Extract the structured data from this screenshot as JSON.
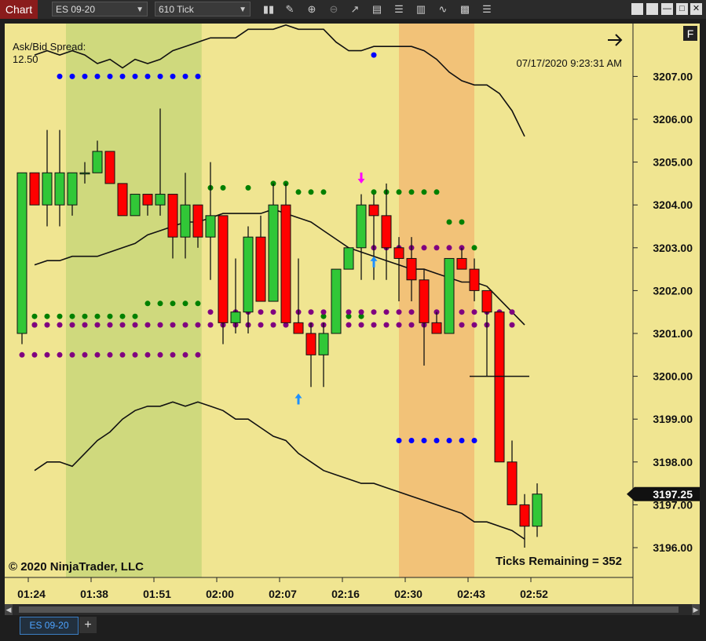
{
  "toolbar": {
    "chart_label": "Chart",
    "instrument": "ES 09-20",
    "interval": "610 Tick"
  },
  "panel": {
    "spread_label": "Ask/Bid Spread:",
    "spread_value": "12.50",
    "datetime": "07/17/2020 9:23:31 AM",
    "copyright": "© 2020 NinjaTrader, LLC",
    "ticks_remaining": "Ticks Remaining = 352",
    "f_badge": "F"
  },
  "bottom": {
    "instrument_tab": "ES 09-20",
    "add_tab": "+"
  },
  "colors": {
    "background": "#f0e591",
    "green_zone": "#cfd97d",
    "orange_zone": "#f2c278",
    "bull": "#31c737",
    "bear": "#ff0000",
    "frame": "#1e1e1e"
  },
  "chart_data": {
    "type": "candlestick",
    "instrument": "ES 09-20",
    "bar_type": "610 Tick",
    "y_axis": {
      "ticks": [
        "3196.00",
        "3197.00",
        "3198.00",
        "3199.00",
        "3200.00",
        "3201.00",
        "3202.00",
        "3203.00",
        "3204.00",
        "3205.00",
        "3206.00",
        "3207.00"
      ],
      "range": [
        3195.5,
        3208.1
      ],
      "last_price": "3197.25"
    },
    "x_axis": {
      "ticks": [
        {
          "label": "01:24",
          "bar": 1
        },
        {
          "label": "01:38",
          "bar": 6
        },
        {
          "label": "01:51",
          "bar": 11
        },
        {
          "label": "02:00",
          "bar": 16
        },
        {
          "label": "02:07",
          "bar": 21
        },
        {
          "label": "02:16",
          "bar": 26
        },
        {
          "label": "02:30",
          "bar": 31
        },
        {
          "label": "02:43",
          "bar": 36
        },
        {
          "label": "02:52",
          "bar": 41
        }
      ]
    },
    "candles": [
      {
        "o": 3201.0,
        "h": 3204.0,
        "l": 3200.75,
        "c": 3204.75
      },
      {
        "o": 3204.75,
        "h": 3204.75,
        "l": 3204.0,
        "c": 3204.0
      },
      {
        "o": 3204.0,
        "h": 3205.75,
        "l": 3203.5,
        "c": 3204.75
      },
      {
        "o": 3204.0,
        "h": 3205.75,
        "l": 3203.5,
        "c": 3204.75
      },
      {
        "o": 3204.0,
        "h": 3204.75,
        "l": 3203.75,
        "c": 3204.75
      },
      {
        "o": 3204.75,
        "h": 3205.0,
        "l": 3204.5,
        "c": 3204.75
      },
      {
        "o": 3204.75,
        "h": 3205.5,
        "l": 3204.75,
        "c": 3205.25
      },
      {
        "o": 3205.25,
        "h": 3205.25,
        "l": 3204.5,
        "c": 3204.5
      },
      {
        "o": 3204.5,
        "h": 3204.5,
        "l": 3203.75,
        "c": 3203.75
      },
      {
        "o": 3203.75,
        "h": 3204.25,
        "l": 3203.75,
        "c": 3204.25
      },
      {
        "o": 3204.25,
        "h": 3204.25,
        "l": 3203.75,
        "c": 3204.0
      },
      {
        "o": 3204.0,
        "h": 3206.25,
        "l": 3203.75,
        "c": 3204.25
      },
      {
        "o": 3204.25,
        "h": 3204.25,
        "l": 3202.75,
        "c": 3203.25
      },
      {
        "o": 3203.25,
        "h": 3204.75,
        "l": 3202.75,
        "c": 3204.0
      },
      {
        "o": 3204.0,
        "h": 3204.0,
        "l": 3203.0,
        "c": 3203.25
      },
      {
        "o": 3203.25,
        "h": 3205.0,
        "l": 3202.25,
        "c": 3203.75
      },
      {
        "o": 3203.75,
        "h": 3203.75,
        "l": 3200.75,
        "c": 3201.25
      },
      {
        "o": 3201.25,
        "h": 3202.75,
        "l": 3201.0,
        "c": 3201.5
      },
      {
        "o": 3201.5,
        "h": 3203.5,
        "l": 3201.0,
        "c": 3203.25
      },
      {
        "o": 3203.25,
        "h": 3203.75,
        "l": 3201.75,
        "c": 3201.75
      },
      {
        "o": 3201.75,
        "h": 3204.5,
        "l": 3201.75,
        "c": 3204.0
      },
      {
        "o": 3204.0,
        "h": 3204.5,
        "l": 3201.25,
        "c": 3201.25
      },
      {
        "o": 3201.25,
        "h": 3202.75,
        "l": 3201.0,
        "c": 3201.0
      },
      {
        "o": 3201.0,
        "h": 3201.25,
        "l": 3199.75,
        "c": 3200.5
      },
      {
        "o": 3200.5,
        "h": 3201.25,
        "l": 3199.75,
        "c": 3201.0
      },
      {
        "o": 3201.0,
        "h": 3202.5,
        "l": 3201.0,
        "c": 3202.5
      },
      {
        "o": 3202.5,
        "h": 3203.0,
        "l": 3202.5,
        "c": 3203.0
      },
      {
        "o": 3203.0,
        "h": 3204.25,
        "l": 3202.25,
        "c": 3204.0
      },
      {
        "o": 3204.0,
        "h": 3204.25,
        "l": 3202.25,
        "c": 3203.75
      },
      {
        "o": 3203.75,
        "h": 3204.5,
        "l": 3202.25,
        "c": 3203.0
      },
      {
        "o": 3203.0,
        "h": 3203.25,
        "l": 3201.75,
        "c": 3202.75
      },
      {
        "o": 3202.75,
        "h": 3203.25,
        "l": 3201.75,
        "c": 3202.25
      },
      {
        "o": 3202.25,
        "h": 3202.5,
        "l": 3200.25,
        "c": 3201.25
      },
      {
        "o": 3201.25,
        "h": 3201.5,
        "l": 3201.0,
        "c": 3201.0
      },
      {
        "o": 3201.0,
        "h": 3202.75,
        "l": 3201.0,
        "c": 3202.75
      },
      {
        "o": 3202.75,
        "h": 3203.0,
        "l": 3202.5,
        "c": 3202.5
      },
      {
        "o": 3202.5,
        "h": 3202.75,
        "l": 3201.75,
        "c": 3202.0
      },
      {
        "o": 3202.0,
        "h": 3202.0,
        "l": 3200.0,
        "c": 3201.5
      },
      {
        "o": 3201.5,
        "h": 3201.5,
        "l": 3198.0,
        "c": 3198.0
      },
      {
        "o": 3198.0,
        "h": 3198.5,
        "l": 3197.0,
        "c": 3197.0
      },
      {
        "o": 3197.0,
        "h": 3197.25,
        "l": 3196.0,
        "c": 3196.5
      },
      {
        "o": 3196.5,
        "h": 3197.5,
        "l": 3196.25,
        "c": 3197.25
      }
    ],
    "upper_band": [
      3207.5,
      3207.6,
      3207.5,
      3207.6,
      3207.5,
      3207.3,
      3207.4,
      3207.2,
      3207.4,
      3207.3,
      3207.4,
      3207.6,
      3207.7,
      3207.8,
      3207.9,
      3207.9,
      3207.9,
      3208.1,
      3208.1,
      3208.1,
      3208.2,
      3208.1,
      3208.1,
      3208.1,
      3207.8,
      3207.6,
      3207.6,
      3207.7,
      3207.7,
      3207.7,
      3207.7,
      3207.6,
      3207.4,
      3207.1,
      3206.9,
      3206.8,
      3206.8,
      3206.6,
      3206.2,
      3205.6
    ],
    "middle_band": [
      3202.6,
      3202.7,
      3202.7,
      3202.8,
      3202.8,
      3202.8,
      3202.9,
      3203.0,
      3203.1,
      3203.3,
      3203.4,
      3203.5,
      3203.6,
      3203.6,
      3203.7,
      3203.8,
      3203.8,
      3203.8,
      3203.8,
      3203.9,
      3203.8,
      3203.7,
      3203.6,
      3203.4,
      3203.2,
      3203.0,
      3202.9,
      3202.8,
      3202.7,
      3202.6,
      3202.5,
      3202.5,
      3202.4,
      3202.3,
      3202.2,
      3202.2,
      3202.1,
      3201.8,
      3201.5,
      3201.2
    ],
    "lower_band": [
      3197.8,
      3198.0,
      3198.0,
      3197.9,
      3198.2,
      3198.5,
      3198.7,
      3199.0,
      3199.2,
      3199.3,
      3199.3,
      3199.4,
      3199.3,
      3199.4,
      3199.3,
      3199.2,
      3199.0,
      3199.0,
      3198.8,
      3198.6,
      3198.5,
      3198.2,
      3198.0,
      3197.8,
      3197.7,
      3197.6,
      3197.5,
      3197.5,
      3197.4,
      3197.3,
      3197.2,
      3197.1,
      3197.0,
      3196.9,
      3196.8,
      3196.6,
      3196.6,
      3196.5,
      3196.4,
      3196.2
    ],
    "background_zones": [
      {
        "color": "green",
        "from_bar": 4.5,
        "to_bar": 15.3
      },
      {
        "color": "orange",
        "from_bar": 31.0,
        "to_bar": 37.0
      }
    ],
    "dot_rows": [
      {
        "color": "blue",
        "price": 3207.0,
        "from_bar": 4,
        "to_bar": 15
      },
      {
        "color": "blue",
        "price": 3198.5,
        "from_bar": 31,
        "to_bar": 37
      },
      {
        "color": "blue",
        "price": 3207.5,
        "from_bar": 29,
        "to_bar": 29
      },
      {
        "color": "green",
        "price": 3204.4,
        "from_bar": 16,
        "to_bar": 17
      },
      {
        "color": "green",
        "price": 3204.4,
        "from_bar": 19,
        "to_bar": 19
      },
      {
        "color": "green",
        "price": 3204.5,
        "from_bar": 21,
        "to_bar": 22
      },
      {
        "color": "green",
        "price": 3204.3,
        "from_bar": 23,
        "to_bar": 25
      },
      {
        "color": "green",
        "price": 3204.3,
        "from_bar": 29,
        "to_bar": 34
      },
      {
        "color": "green",
        "price": 3203.6,
        "from_bar": 35,
        "to_bar": 36
      },
      {
        "color": "green",
        "price": 3203.0,
        "from_bar": 37,
        "to_bar": 37
      },
      {
        "color": "green",
        "price": 3201.7,
        "from_bar": 11,
        "to_bar": 15
      },
      {
        "color": "green",
        "price": 3201.4,
        "from_bar": 1,
        "to_bar": 10
      },
      {
        "color": "green",
        "price": 3201.4,
        "from_bar": 25,
        "to_bar": 28
      },
      {
        "color": "green",
        "price": 3201.2,
        "from_bar": 1,
        "to_bar": 2
      },
      {
        "color": "purple",
        "price": 3201.2,
        "from_bar": 1,
        "to_bar": 15
      },
      {
        "color": "purple",
        "price": 3200.5,
        "from_bar": 1,
        "to_bar": 15
      },
      {
        "color": "purple",
        "price": 3201.2,
        "from_bar": 16,
        "to_bar": 40
      },
      {
        "color": "purple",
        "price": 3201.5,
        "from_bar": 16,
        "to_bar": 40
      },
      {
        "color": "purple",
        "price": 3203.0,
        "from_bar": 29,
        "to_bar": 36
      }
    ],
    "markers": [
      {
        "type": "arrow-down",
        "color": "magenta",
        "bar": 28,
        "price": 3204.5
      },
      {
        "type": "arrow-up",
        "color": "dodgerblue",
        "bar": 29,
        "price": 3202.8
      },
      {
        "type": "arrow-up",
        "color": "dodgerblue",
        "bar": 23,
        "price": 3199.6
      }
    ],
    "hline": {
      "price": 3200.0,
      "from_bar": 37,
      "to_bar": 41
    }
  }
}
